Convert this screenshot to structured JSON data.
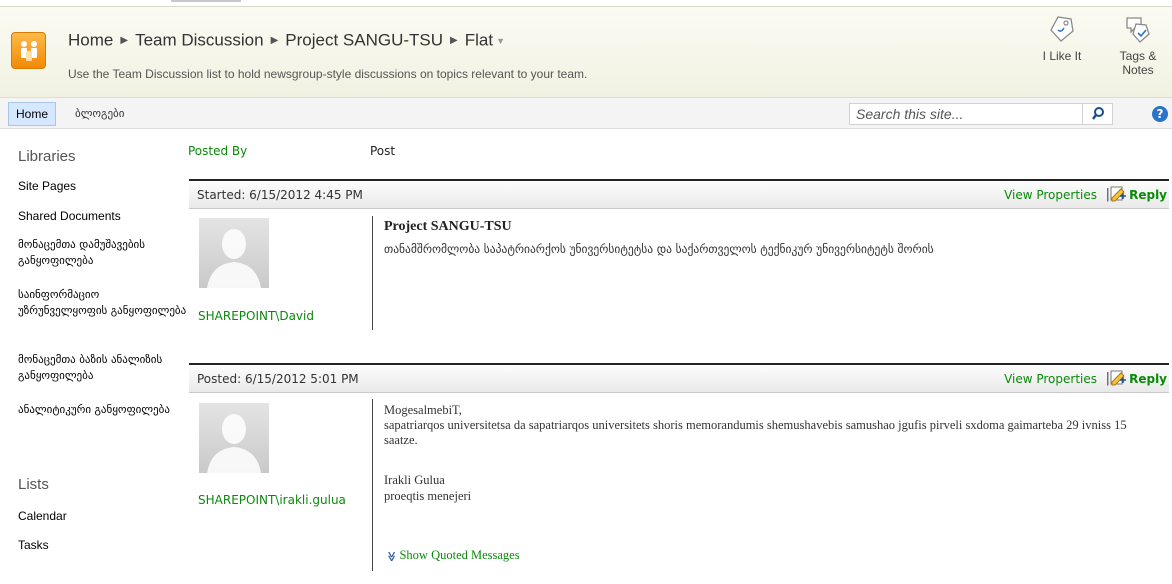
{
  "breadcrumb": {
    "home": "Home",
    "list": "Team Discussion",
    "item": "Project SANGU-TSU",
    "view": "Flat",
    "description": "Use the Team Discussion list to hold newsgroup-style discussions on topics relevant to your team."
  },
  "social": {
    "like_label": "I Like It",
    "tags_label": "Tags &",
    "tags_label2": "Notes"
  },
  "topnav": {
    "home": "Home",
    "blogs": "ბლოგები"
  },
  "search": {
    "placeholder": "Search this site..."
  },
  "help": {
    "label": "?"
  },
  "leftnav": {
    "libraries_heading": "Libraries",
    "libraries": [
      "Site Pages",
      "Shared Documents",
      "მონაცემთა დამუშავების განყოფილება",
      "საინფორმაციო უზრუნველყოფის განყოფილება",
      "მონაცემთა ბაზის ანალიზის განყოფილება",
      "ანალიტიკური განყოფილება"
    ],
    "lists_heading": "Lists",
    "lists": [
      "Calendar",
      "Tasks"
    ]
  },
  "columns": {
    "posted_by": "Posted By",
    "post": "Post"
  },
  "posts": [
    {
      "header": "Started: 6/15/2012 4:45 PM",
      "view_properties": "View Properties",
      "separator": "|",
      "reply": "Reply",
      "author": "SHAREPOINT\\David",
      "title": "Project SANGU-TSU",
      "body": "თანამშრომლობა საპატრიარქოს უნივერსიტეტსა და საქართველოს ტექნიკურ უნივერსიტეტს შორის"
    },
    {
      "header": "Posted: 6/15/2012 5:01 PM",
      "view_properties": "View Properties",
      "separator": "|",
      "reply": "Reply",
      "author": "SHAREPOINT\\irakli.gulua",
      "line1": "MogesalmebiT,",
      "line2": "sapatriarqos universitetsa da sapatriarqos universitets shoris memorandumis shemushavebis samushao jgufis pirveli sxdoma gaimarteba 29 ivniss 15 saatze.",
      "signature_name": "Irakli Gulua",
      "signature_role": "proeqtis menejeri",
      "show_quoted": "Show Quoted Messages"
    }
  ],
  "colors": {
    "link_green": "#0a8a0a",
    "accent_orange": "#f28a05",
    "nav_selected": "#d6e8ff"
  }
}
